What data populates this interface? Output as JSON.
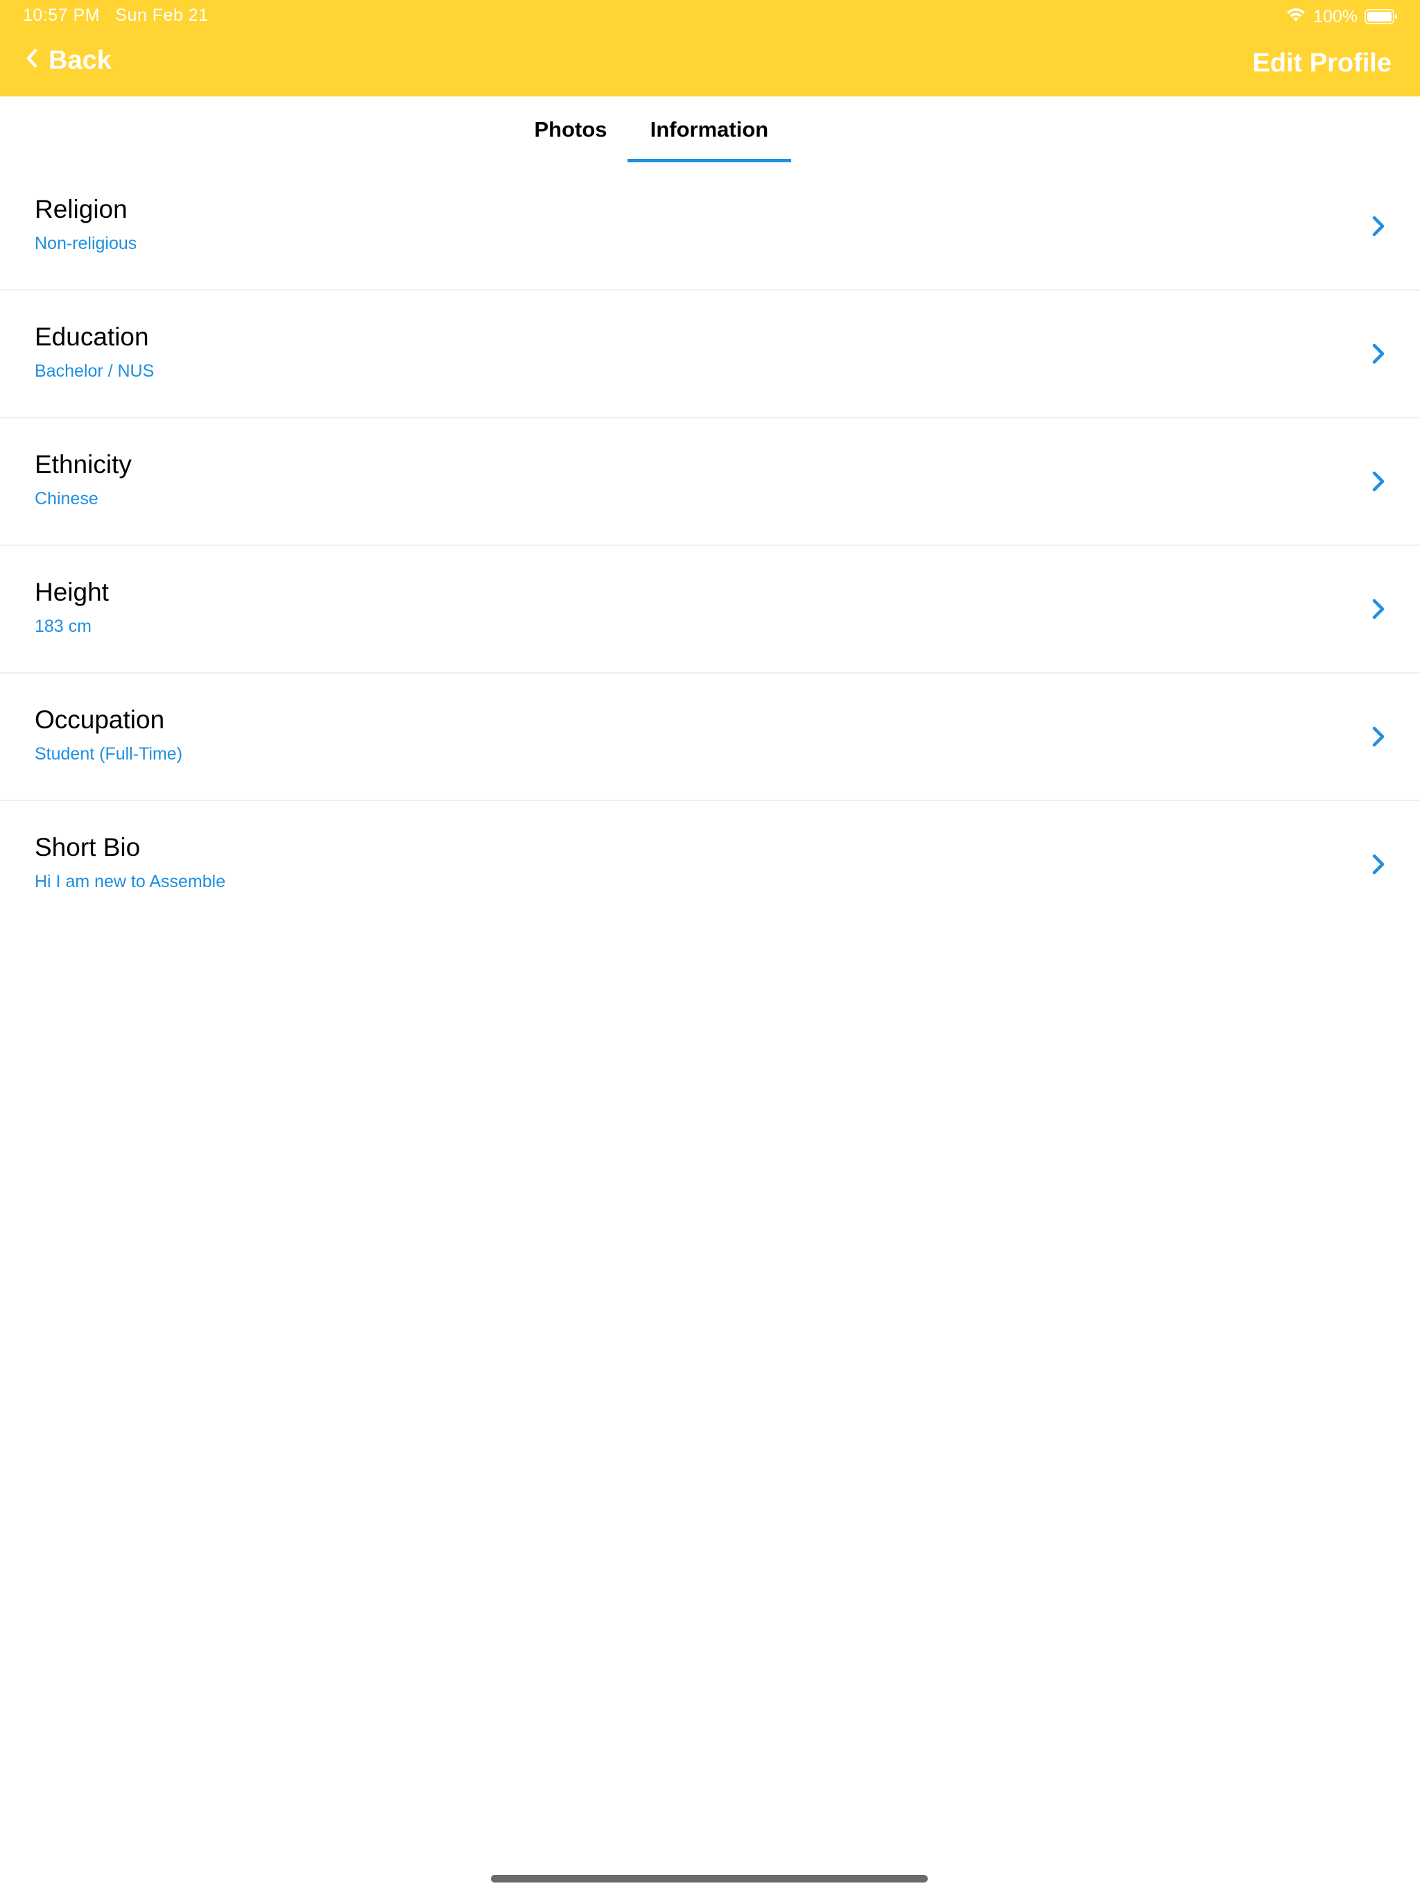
{
  "status_bar": {
    "time": "10:57 PM",
    "date": "Sun Feb 21",
    "battery": "100%"
  },
  "nav": {
    "back_label": "Back",
    "title": "Edit Profile"
  },
  "tabs": [
    {
      "label": "Photos",
      "active": false
    },
    {
      "label": "Information",
      "active": true
    }
  ],
  "fields": [
    {
      "title": "Religion",
      "value": "Non-religious"
    },
    {
      "title": "Education",
      "value": "Bachelor / NUS"
    },
    {
      "title": "Ethnicity",
      "value": "Chinese"
    },
    {
      "title": "Height",
      "value": "183 cm"
    },
    {
      "title": "Occupation",
      "value": "Student (Full-Time)"
    },
    {
      "title": "Short Bio",
      "value": "Hi I am new to Assemble"
    }
  ],
  "colors": {
    "header": "#FFD433",
    "accent": "#1E8FE1"
  }
}
